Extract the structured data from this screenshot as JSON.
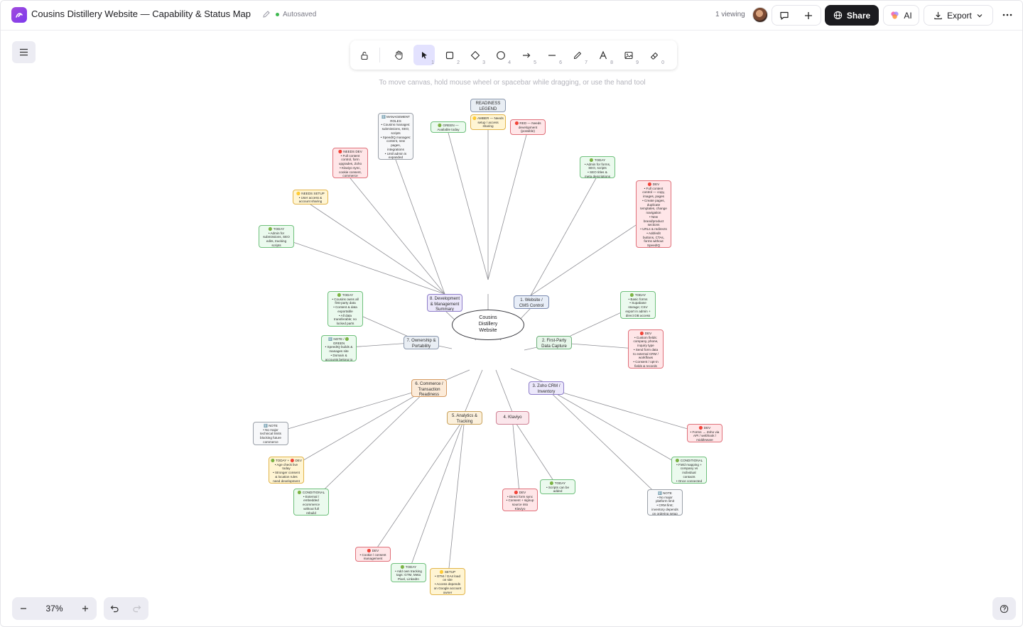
{
  "header": {
    "title": "Cousins Distillery Website — Capability & Status Map",
    "autosave": "Autosaved",
    "viewing": "1 viewing",
    "share_label": "Share",
    "ai_label": "AI",
    "export_label": "Export"
  },
  "toolbar": {
    "hint": "To move canvas, hold mouse wheel or spacebar while dragging, or use the hand tool",
    "tools": [
      {
        "name": "lock",
        "num": ""
      },
      {
        "name": "hand",
        "num": ""
      },
      {
        "name": "select",
        "num": "1"
      },
      {
        "name": "rectangle",
        "num": "2"
      },
      {
        "name": "diamond",
        "num": "3"
      },
      {
        "name": "ellipse",
        "num": "4"
      },
      {
        "name": "arrow",
        "num": "5"
      },
      {
        "name": "line",
        "num": "6"
      },
      {
        "name": "draw",
        "num": "7"
      },
      {
        "name": "text",
        "num": "8"
      },
      {
        "name": "image",
        "num": "9"
      },
      {
        "name": "eraser",
        "num": "0"
      }
    ]
  },
  "zoom": {
    "level": "37%"
  },
  "colors": {
    "accent": "#7c3aed",
    "active_tool_bg": "#e3e2fe",
    "share_bg": "#1b1b1f"
  },
  "map": {
    "center": "Cousins\nDistillery\nWebsite",
    "branches": {
      "website_cms": "1. Website /\nCMS Control",
      "first_party": "2. First-Party\nData Capture",
      "zoho": "3. Zoho CRM /\nInventory",
      "klaviyo": "4. Klaviyo",
      "analytics": "5. Analytics &\nTracking",
      "commerce": "6. Commerce /\nTransaction\nReadiness",
      "ownership": "7. Ownership &\nPortability",
      "dev_mgmt": "8. Development\n& Management\nSummary"
    },
    "legend": {
      "title": "READINESS\nLEGEND",
      "green": "🟢 GREEN —\nAvailable today",
      "amber": "🟡 AMBER — Needs\nsetup / access\nsharing",
      "red": "🔴 RED — Needs\ndevelopment\n(possible)"
    },
    "leaves": {
      "mgmt_roles": "ℹ️ MANAGEMENT\nROLES\n• Cousins manages:\nsubmissions, SEO,\nscripts\n• SpeedIQ manages:\ncontent, new\npages,\nintegrations\n• Until admin is\nexpanded",
      "needs_dev": "🔴 NEEDS DEV\n• Full content\ncontrol, form\nupgrades, Zoho\n• Klaviyo sync,\ncookie consent,\ncommerce",
      "needs_setup": "🟡 NEEDS SETUP\n• User access &\naccount sharing",
      "today_admin": "🟢 TODAY\n• Admin for\nsubmissions, SEO\nedits, tracking\nscripts",
      "cms_today": "🟢 TODAY\n• Admin for forms,\nSEO, scripts\n• SEO titles &\nmeta descriptions",
      "cms_dev": "🔴 DEV\n• Full content\ncontrol — copy,\nimages, pages\n• Create pages,\nduplicate\ntemplates, change\nnavigation\n• New\nbrand/product\nsections\n• URLs & redirects\n• Add/edit\nbuttons, CTAs,\nforms without\nSpeedIQ",
      "own_today": "🟢 TODAY\n• Cousins owns all\nfirst-party data\n• Content & data\nexportable\n• All data\ntransferable; no\nlocked parts",
      "own_note": "ℹ️ NOTE / 🟢 GREEN\n• SpeedIQ builds &\nmanages site\n• Domain &\naccounts belong to\nCousins",
      "fp_today": "🟢 TODAY\n• Basic forms\n• Supabase\nstorage; CSV\nexport in admin +\ndirect DB access",
      "fp_dev": "🔴 DEV\n• Custom fields:\ncompany, phone,\ninquiry type\n• Send form data\nto external CRM /\nworkflows\n• Consent / opt-in\nfields & records",
      "zoho_dev": "🔴 DEV\n• Forms → Zoho via\nAPI / webhook /\nmiddleware",
      "zoho_cond": "🟢 CONDITIONAL\n• Field mapping +\ncompany vs\nindividual\ncontacts\n• Once connected",
      "zoho_note": "ℹ️ NOTE\n• No major\nplatform limit\n• CRM first;\ninventory depends\non ordering setup",
      "kl_dev": "🔴 DEV\n• Direct form sync\n• Consent + signup\nsource into\nKlaviyo",
      "kl_today": "🟢 TODAY\n• Scripts can be\nadded",
      "an_dev": "🔴 DEV\n• Cookie / consent\nmanagement",
      "an_today": "🟢 TODAY\n• Add own tracking\ntags: GTM, Meta\nPixel, LinkedIn",
      "an_setup": "🟡 SETUP\n• GTM / GA4 load\non site\n• Access depends\non Google account\nowner",
      "com_note": "ℹ️ NOTE\n• No major\ntechnical limits\nblocking future\ncommerce",
      "com_today_dev": "🟢 TODAY + 🔴 DEV\n• Age check live\ntoday\n• Stronger consent\n& location rules\nneed development",
      "com_cond": "🟢 CONDITIONAL\n• External /\nembedded ecommerce\nwithout full\nrebuild\n• Depends on setup"
    }
  }
}
